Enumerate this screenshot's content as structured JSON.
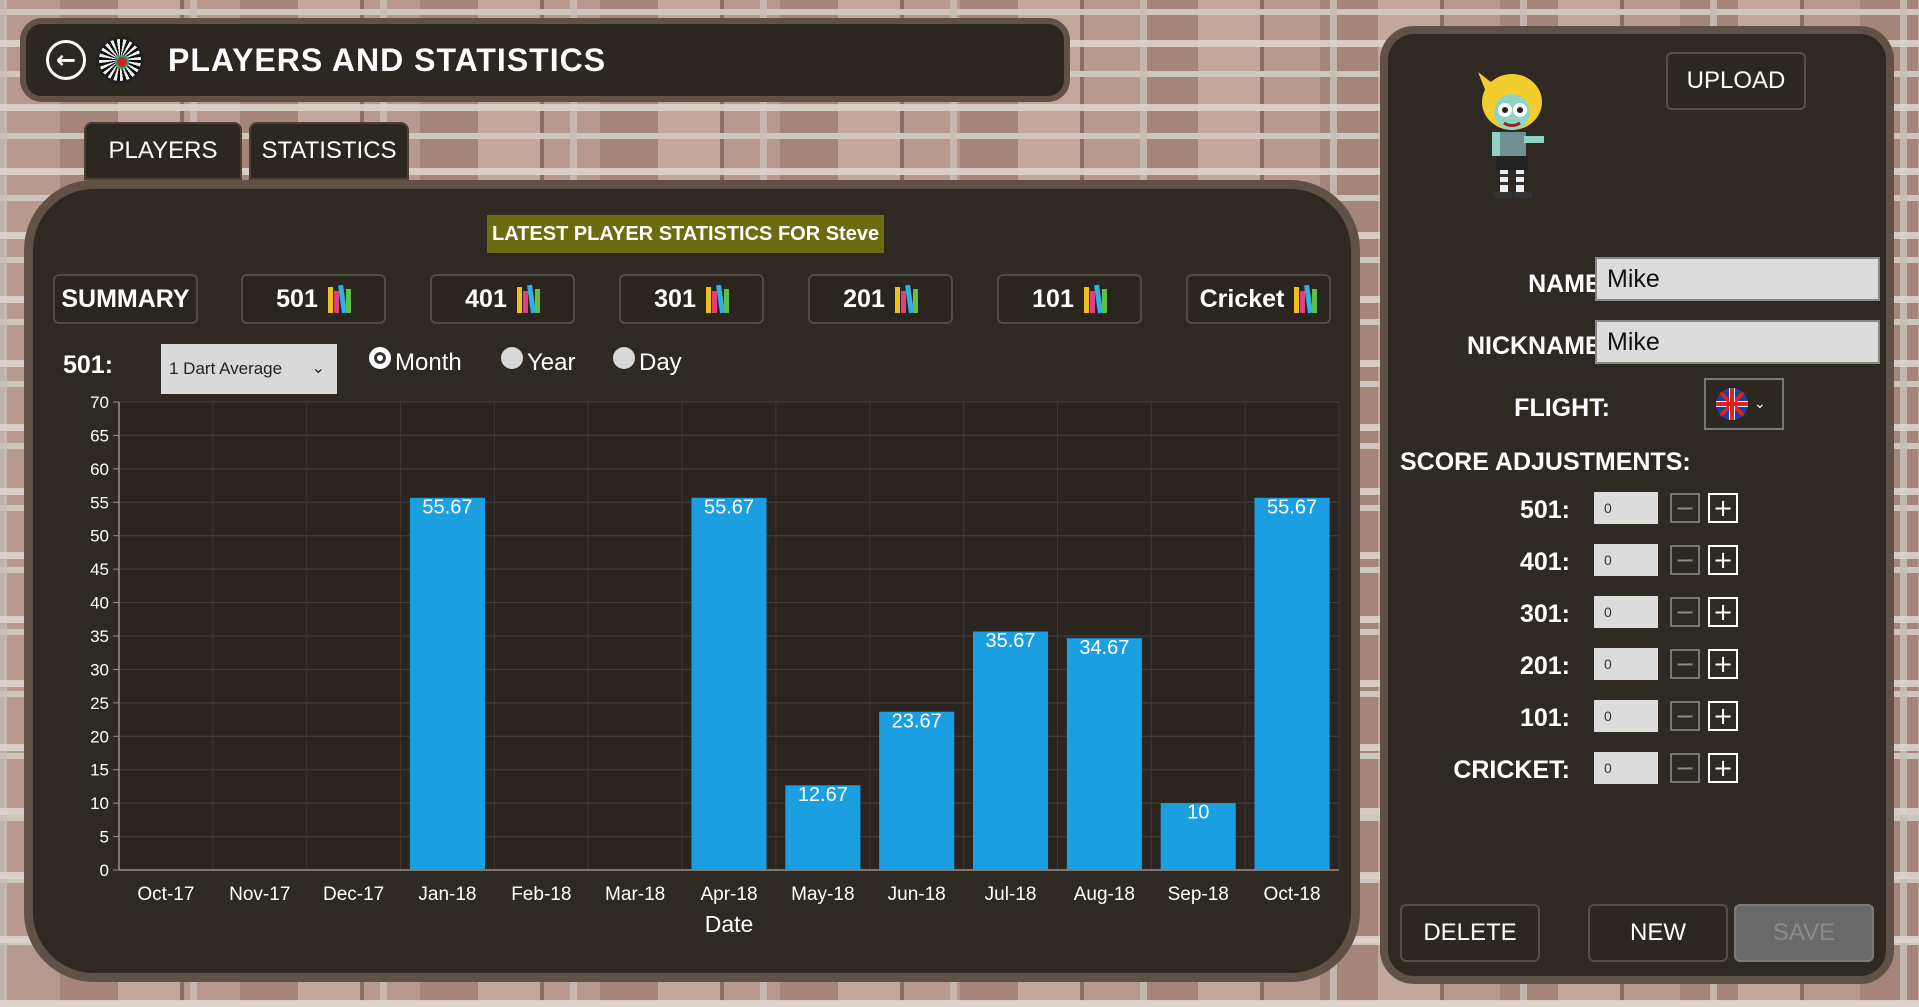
{
  "header": {
    "title": "PLAYERS AND STATISTICS"
  },
  "tabs": [
    {
      "label": "PLAYERS"
    },
    {
      "label": "STATISTICS"
    }
  ],
  "main": {
    "banner": "LATEST PLAYER STATISTICS FOR Steve",
    "game_buttons": [
      {
        "label": "SUMMARY",
        "icon": ""
      },
      {
        "label": "501",
        "icon": "books-icon"
      },
      {
        "label": "401",
        "icon": "books-icon"
      },
      {
        "label": "301",
        "icon": "books-icon"
      },
      {
        "label": "201",
        "icon": "books-icon"
      },
      {
        "label": "101",
        "icon": "books-icon"
      },
      {
        "label": "Cricket",
        "icon": "books-icon"
      }
    ],
    "filter_label": "501:",
    "metric_select": "1 Dart Average",
    "periods": [
      {
        "label": "Month",
        "checked": true
      },
      {
        "label": "Year",
        "checked": false
      },
      {
        "label": "Day",
        "checked": false
      }
    ]
  },
  "chart_data": {
    "type": "bar",
    "categories": [
      "Oct-17",
      "Nov-17",
      "Dec-17",
      "Jan-18",
      "Feb-18",
      "Mar-18",
      "Apr-18",
      "May-18",
      "Jun-18",
      "Jul-18",
      "Aug-18",
      "Sep-18",
      "Oct-18"
    ],
    "values": [
      0,
      0,
      0,
      55.67,
      0,
      0,
      55.67,
      12.67,
      23.67,
      35.67,
      34.67,
      10,
      55.67
    ],
    "data_labels": [
      "",
      "",
      "",
      "55.67",
      "",
      "",
      "55.67",
      "12.67",
      "23.67",
      "35.67",
      "34.67",
      "10",
      "55.67"
    ],
    "xlabel": "Date",
    "ylabel": "",
    "ylim": [
      0,
      70
    ],
    "yticks": [
      0,
      5,
      10,
      15,
      20,
      25,
      30,
      35,
      40,
      45,
      50,
      55,
      60,
      65,
      70
    ],
    "grid": true,
    "bar_color": "#1c9fe0"
  },
  "side": {
    "upload_label": "UPLOAD",
    "name_label": "NAME:",
    "name_value": "Mike",
    "nickname_label": "NICKNAME:",
    "nickname_value": "Mike",
    "flight_label": "FLIGHT:",
    "flight_value": "uk-flag-icon",
    "score_heading": "SCORE ADJUSTMENTS:",
    "scores": [
      {
        "label": "501:",
        "value": "0"
      },
      {
        "label": "401:",
        "value": "0"
      },
      {
        "label": "301:",
        "value": "0"
      },
      {
        "label": "201:",
        "value": "0"
      },
      {
        "label": "101:",
        "value": "0"
      },
      {
        "label": "CRICKET:",
        "value": "0"
      }
    ],
    "delete_label": "DELETE",
    "new_label": "NEW",
    "save_label": "SAVE"
  }
}
